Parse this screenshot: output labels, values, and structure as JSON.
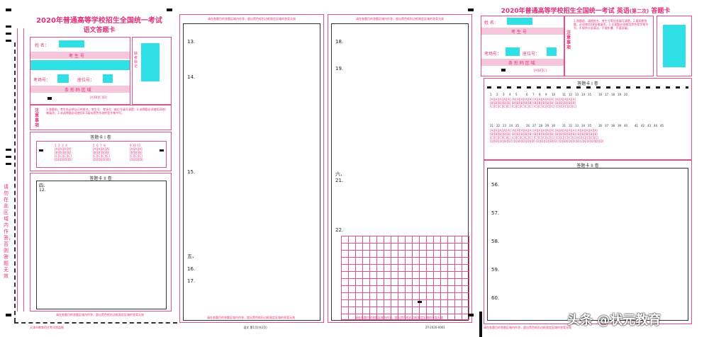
{
  "chinese_sheet": {
    "title_line1": "2020年普通高等学校招生全国统一考试",
    "title_line2": "语文答题卡",
    "name_label": "姓 名：",
    "exam_no_label": "考 生 号",
    "seat_label": "考场号：",
    "seat2_label": "座位号：",
    "barcode_label": "条 形 码 区 域",
    "sticker_label": "缺考标记",
    "notice_label": "注意事项",
    "notice_text": "1.答题前，考生务必将自己的姓名、考生号、考场号、座位号填写清楚；2.选择题必须使用2B铅笔填涂；3.非选择题必须使用0.5毫米黑色字迹的签字笔书写。",
    "section1_title": "答题卡 I 卷",
    "section2_title": "答题卡 II 卷",
    "q_four": "四、",
    "q12": "12.",
    "side_text": "请勿在此区域内作答，否则答题无效",
    "footer_warning": "请在各题目的答题区域内作答，超出黑色矩形边框限定区域的答案无效",
    "footer_code": "天津市教育招生考试院监制"
  },
  "mid_sheets": {
    "header_warning": "请在各题目的答题区域内作答，超出黑色矩形边框限定区域的答案无效",
    "q13": "13.",
    "q14": "14.",
    "q15": "15.",
    "q_five": "五、",
    "q16": "16.",
    "q17": "17.",
    "q18": "18.",
    "q19": "19.",
    "q_six": "六、",
    "q21": "21.",
    "q22": "22.",
    "footer_page": "语文 第1页(共2页)",
    "footer_code2": "ZY-2020-0001"
  },
  "english_sheet": {
    "title_line1": "2020年普通高等学校招生全国统一考试",
    "title_subject": "英语",
    "title_suffix": "(第二次)",
    "title_card": "答题卡",
    "name_label": "姓 名：",
    "exam_no_label": "考 生 号",
    "seat_label": "考场号：",
    "seat2_label": "座位号：",
    "barcode_label": "条 形 码 区 域",
    "notice_label": "注意事项",
    "notice_text": "1.答题前，请将姓名、考生号等信息填写清楚。2.客观题答题，必须使用2B铅笔填涂。3.主观题必须使用黑色签字笔书写。4.保持卡面清洁，不要折叠、不要弄破。",
    "section1_title": "答题卡 I 卷",
    "section2_title": "答题卡 II 卷",
    "row1_numbers": [
      "1",
      "2",
      "3",
      "4",
      "5",
      "6",
      "7",
      "8",
      "9",
      "10",
      "11",
      "12",
      "13",
      "14",
      "15",
      "16",
      "17",
      "18",
      "19",
      "20"
    ],
    "row2_numbers": [
      "21",
      "22",
      "23",
      "24",
      "25",
      "26",
      "27",
      "28",
      "29",
      "30",
      "31",
      "32",
      "33",
      "34",
      "35",
      "36",
      "37",
      "38",
      "39",
      "40",
      "41",
      "42",
      "43",
      "44",
      "45"
    ],
    "q56": "56.",
    "q57": "57.",
    "q58": "58.",
    "q59": "59.",
    "q60": "60.",
    "footer_warning": "请在各题目的答题区域内作答，超出黑色矩形边框限定区域的答案无效"
  },
  "watermark": "头条 @状元教育",
  "colors": {
    "accent": "#e0307a",
    "fill": "#2fe0e6"
  }
}
